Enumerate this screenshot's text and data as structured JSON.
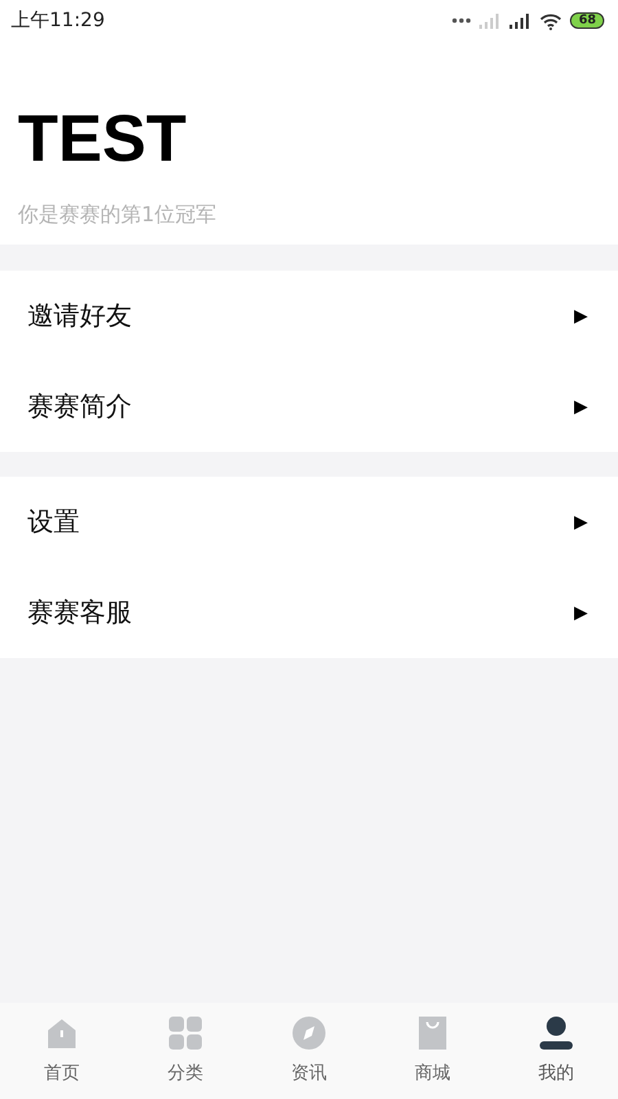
{
  "status_bar": {
    "time": "上午11:29",
    "battery": "68"
  },
  "profile": {
    "name": "TEST",
    "subtitle": "你是赛赛的第1位冠军"
  },
  "menu_groups": [
    {
      "items": [
        {
          "label": "邀请好友",
          "arrow": "▶"
        },
        {
          "label": "赛赛简介",
          "arrow": "▶"
        }
      ]
    },
    {
      "items": [
        {
          "label": "设置",
          "arrow": "▶"
        },
        {
          "label": "赛赛客服",
          "arrow": "▶"
        }
      ]
    }
  ],
  "tabs": [
    {
      "kind": "home",
      "label": "首页",
      "selected": false
    },
    {
      "kind": "grid",
      "label": "分类",
      "selected": false
    },
    {
      "kind": "compass",
      "label": "资讯",
      "selected": false
    },
    {
      "kind": "bag",
      "label": "商城",
      "selected": false
    },
    {
      "kind": "person",
      "label": "我的",
      "selected": true
    }
  ]
}
